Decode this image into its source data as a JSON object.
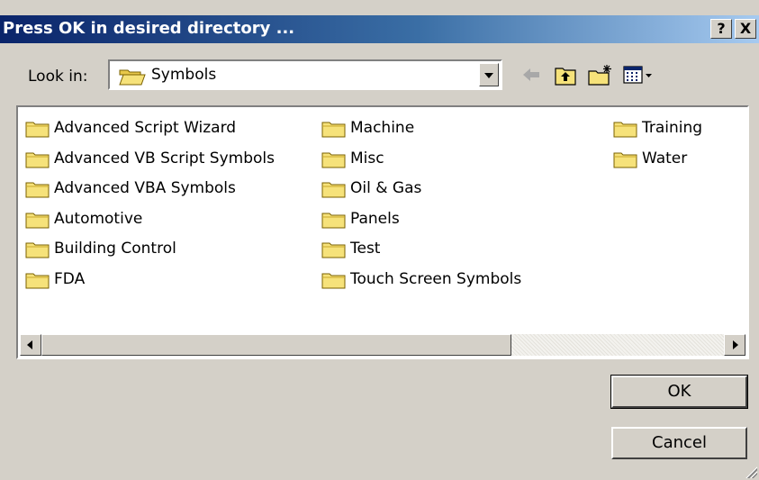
{
  "window": {
    "title": "Press OK in desired directory ...",
    "help_label": "?",
    "close_label": "X"
  },
  "look_in": {
    "label": "Look in:",
    "value": "Symbols"
  },
  "toolbar": {
    "icons": [
      "back-arrow-icon",
      "up-folder-icon",
      "new-folder-icon",
      "view-menu-icon"
    ]
  },
  "folders": {
    "col1": [
      "Advanced Script Wizard",
      "Advanced VB Script Symbols",
      "Advanced VBA Symbols",
      "Automotive",
      "Building Control",
      "FDA"
    ],
    "col2": [
      "Machine",
      "Misc",
      "Oil & Gas",
      "Panels",
      "Test",
      "Touch Screen Symbols"
    ],
    "col3": [
      "Training",
      "Water"
    ]
  },
  "buttons": {
    "ok": "OK",
    "cancel": "Cancel"
  },
  "colors": {
    "title_start": "#0a246a",
    "title_end": "#a6caf0",
    "face": "#d4d0c8",
    "folder": "#f6e27a"
  }
}
